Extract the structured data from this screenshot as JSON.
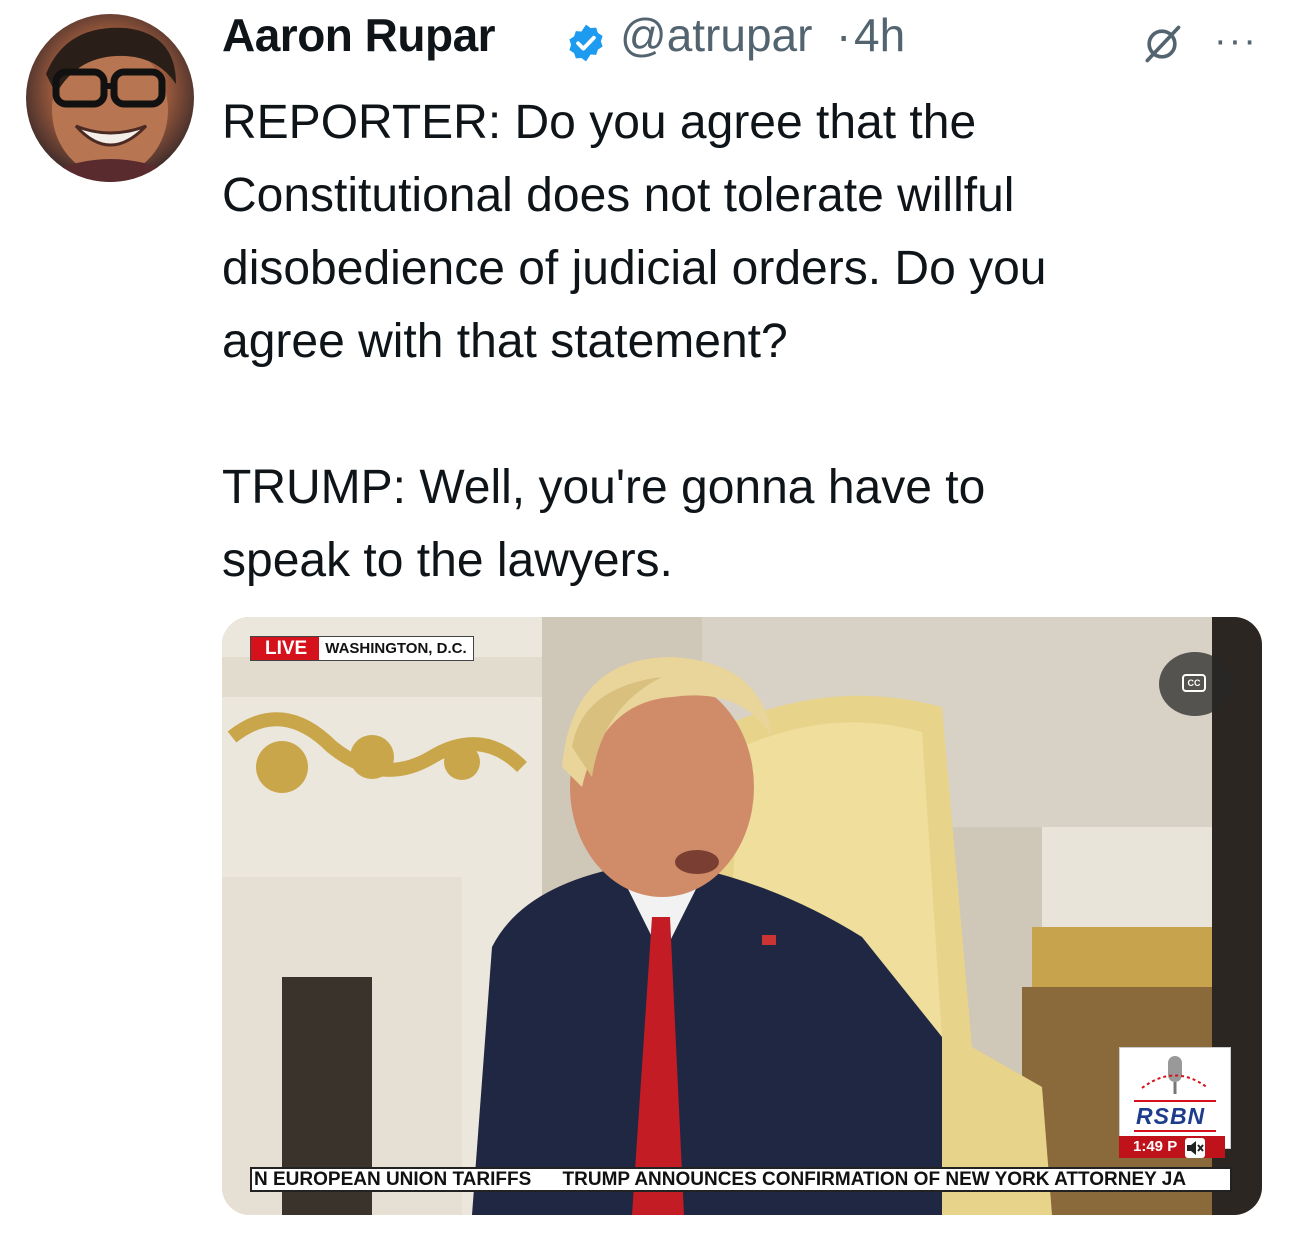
{
  "author": {
    "name": "Aaron Rupar",
    "handle": "@atrupar",
    "separator": "·",
    "time": "4h",
    "verified": true,
    "verified_color": "#1d9bf0"
  },
  "icons": {
    "verified": "verified-badge-icon",
    "grok": "grok-icon",
    "more": "more-icon",
    "cc": "closed-captions-icon",
    "mute": "muted-speaker-icon"
  },
  "more_label": "···",
  "tweet": {
    "text": "REPORTER: Do you agree that the\nConstitutional does not tolerate willful\ndisobedience of judicial orders. Do you\nagree with that statement?\n\nTRUMP: Well, you're gonna have to\nspeak to the lawyers."
  },
  "media": {
    "live_label": "LIVE",
    "location": "WASHINGTON, D.C.",
    "cc_label": "CC",
    "network_logo": "RSBN",
    "clock": "1:49 P",
    "ticker_left": "N EUROPEAN UNION TARIFFS",
    "ticker_right": "TRUMP ANNOUNCES CONFIRMATION OF NEW YORK ATTORNEY JA",
    "colors": {
      "live_red": "#d5121b",
      "rsbn_blue": "#1e3c8c"
    }
  }
}
